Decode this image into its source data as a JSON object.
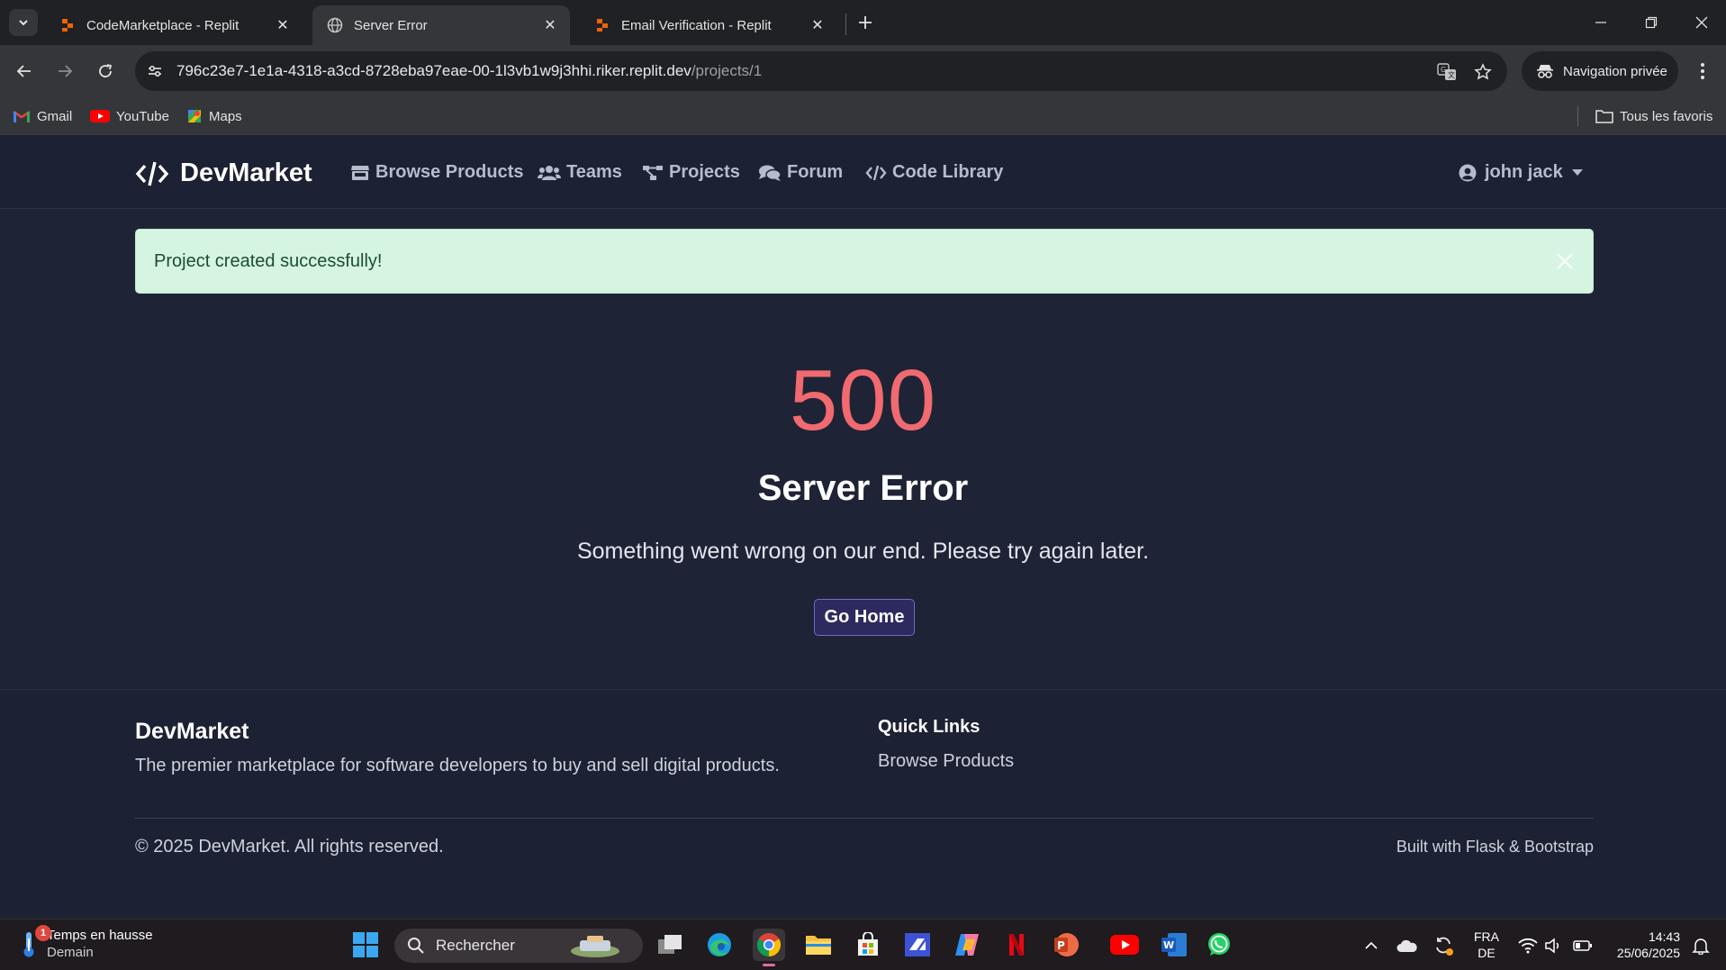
{
  "browser": {
    "tabs": [
      {
        "title": "CodeMarketplace - Replit",
        "active": false
      },
      {
        "title": "Server Error",
        "active": true
      },
      {
        "title": "Email Verification - Replit",
        "active": false
      }
    ],
    "url_host": "796c23e7-1e1a-4318-a3cd-8728eba97eae-00-1l3vb1w9j3hhi.riker.replit.dev",
    "url_path": "/projects/1",
    "private_label": "Navigation privée",
    "bookmarks": [
      {
        "label": "Gmail",
        "icon": "gmail-icon"
      },
      {
        "label": "YouTube",
        "icon": "youtube-icon"
      },
      {
        "label": "Maps",
        "icon": "maps-icon"
      }
    ],
    "all_bookmarks_label": "Tous les favoris"
  },
  "site": {
    "brand": "DevMarket",
    "nav": [
      {
        "label": "Browse Products",
        "icon": "store-icon"
      },
      {
        "label": "Teams",
        "icon": "users-icon"
      },
      {
        "label": "Projects",
        "icon": "project-diagram-icon"
      },
      {
        "label": "Forum",
        "icon": "comments-icon"
      },
      {
        "label": "Code Library",
        "icon": "code-icon"
      }
    ],
    "user_name": "john jack"
  },
  "alert": {
    "message": "Project created successfully!"
  },
  "error": {
    "code": "500",
    "title": "Server Error",
    "message": "Something went wrong on our end. Please try again later.",
    "button": "Go Home"
  },
  "footer": {
    "brand": "DevMarket",
    "tagline": "The premier marketplace for software developers to buy and sell digital products.",
    "quick_links_title": "Quick Links",
    "quick_links": [
      "Browse Products"
    ],
    "copyright": "© 2025 DevMarket. All rights reserved.",
    "built_with": "Built with Flask & Bootstrap"
  },
  "taskbar": {
    "weather_title": "Temps en hausse",
    "weather_sub": "Demain",
    "weather_badge": "1",
    "search_placeholder": "Rechercher",
    "lang_top": "FRA",
    "lang_bottom": "DE",
    "time": "14:43",
    "date": "25/06/2025"
  },
  "colors": {
    "page_bg": "#1f2336",
    "error_code": "#f06a6f",
    "alert_bg": "#d5f5e2",
    "button_border": "#6f6cc8"
  }
}
